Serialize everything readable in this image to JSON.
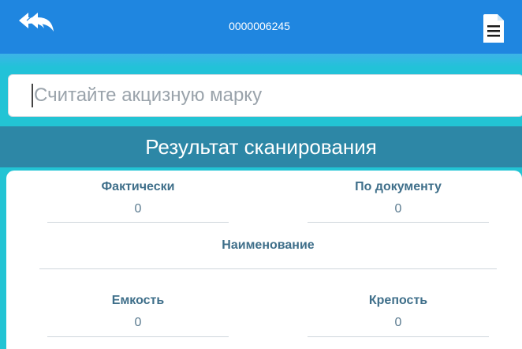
{
  "header": {
    "title": "0000006245",
    "back_icon": "back-arrow-icon",
    "doc_icon": "document-icon",
    "background": "#1f86e0"
  },
  "search": {
    "placeholder": "Считайте акцизную марку",
    "value": ""
  },
  "section": {
    "title": "Результат сканирования",
    "background": "#2d87a6"
  },
  "fields": {
    "actual": {
      "label": "Фактически",
      "value": "0"
    },
    "by_document": {
      "label": "По документу",
      "value": "0"
    },
    "name": {
      "label": "Наименование",
      "value": ""
    },
    "capacity": {
      "label": "Емкость",
      "value": "0"
    },
    "strength": {
      "label": "Крепость",
      "value": "0"
    }
  },
  "colors": {
    "accent": "#22c4d4",
    "label": "#3f6f8a"
  }
}
